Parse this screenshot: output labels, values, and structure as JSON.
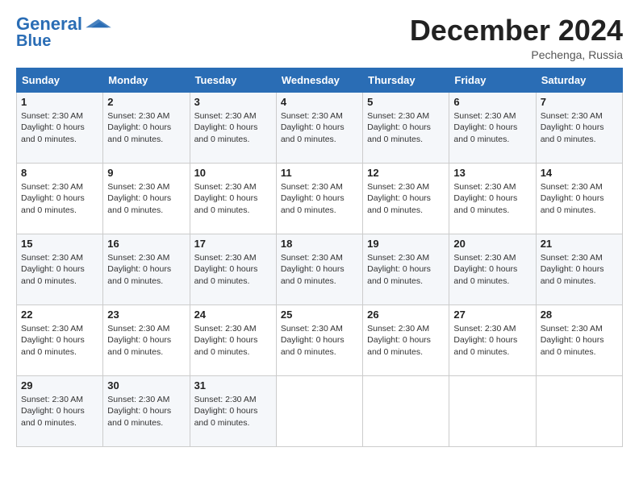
{
  "logo": {
    "line1": "General",
    "line2": "Blue",
    "icon_color": "#2a6db5"
  },
  "title": "December 2024",
  "location": "Pechenga, Russia",
  "days_of_week": [
    "Sunday",
    "Monday",
    "Tuesday",
    "Wednesday",
    "Thursday",
    "Friday",
    "Saturday"
  ],
  "cell_info": {
    "sunset": "Sunset: 2:30 AM",
    "daylight": "Daylight: 0 hours and 0 minutes."
  },
  "weeks": [
    [
      {
        "day": "1",
        "empty": false
      },
      {
        "day": "2",
        "empty": false
      },
      {
        "day": "3",
        "empty": false
      },
      {
        "day": "4",
        "empty": false
      },
      {
        "day": "5",
        "empty": false
      },
      {
        "day": "6",
        "empty": false
      },
      {
        "day": "7",
        "empty": false
      }
    ],
    [
      {
        "day": "8",
        "empty": false
      },
      {
        "day": "9",
        "empty": false
      },
      {
        "day": "10",
        "empty": false
      },
      {
        "day": "11",
        "empty": false
      },
      {
        "day": "12",
        "empty": false
      },
      {
        "day": "13",
        "empty": false
      },
      {
        "day": "14",
        "empty": false
      }
    ],
    [
      {
        "day": "15",
        "empty": false
      },
      {
        "day": "16",
        "empty": false
      },
      {
        "day": "17",
        "empty": false
      },
      {
        "day": "18",
        "empty": false
      },
      {
        "day": "19",
        "empty": false
      },
      {
        "day": "20",
        "empty": false
      },
      {
        "day": "21",
        "empty": false
      }
    ],
    [
      {
        "day": "22",
        "empty": false
      },
      {
        "day": "23",
        "empty": false
      },
      {
        "day": "24",
        "empty": false
      },
      {
        "day": "25",
        "empty": false
      },
      {
        "day": "26",
        "empty": false
      },
      {
        "day": "27",
        "empty": false
      },
      {
        "day": "28",
        "empty": false
      }
    ],
    [
      {
        "day": "29",
        "empty": false
      },
      {
        "day": "30",
        "empty": false
      },
      {
        "day": "31",
        "empty": false
      },
      {
        "day": "",
        "empty": true
      },
      {
        "day": "",
        "empty": true
      },
      {
        "day": "",
        "empty": true
      },
      {
        "day": "",
        "empty": true
      }
    ]
  ]
}
